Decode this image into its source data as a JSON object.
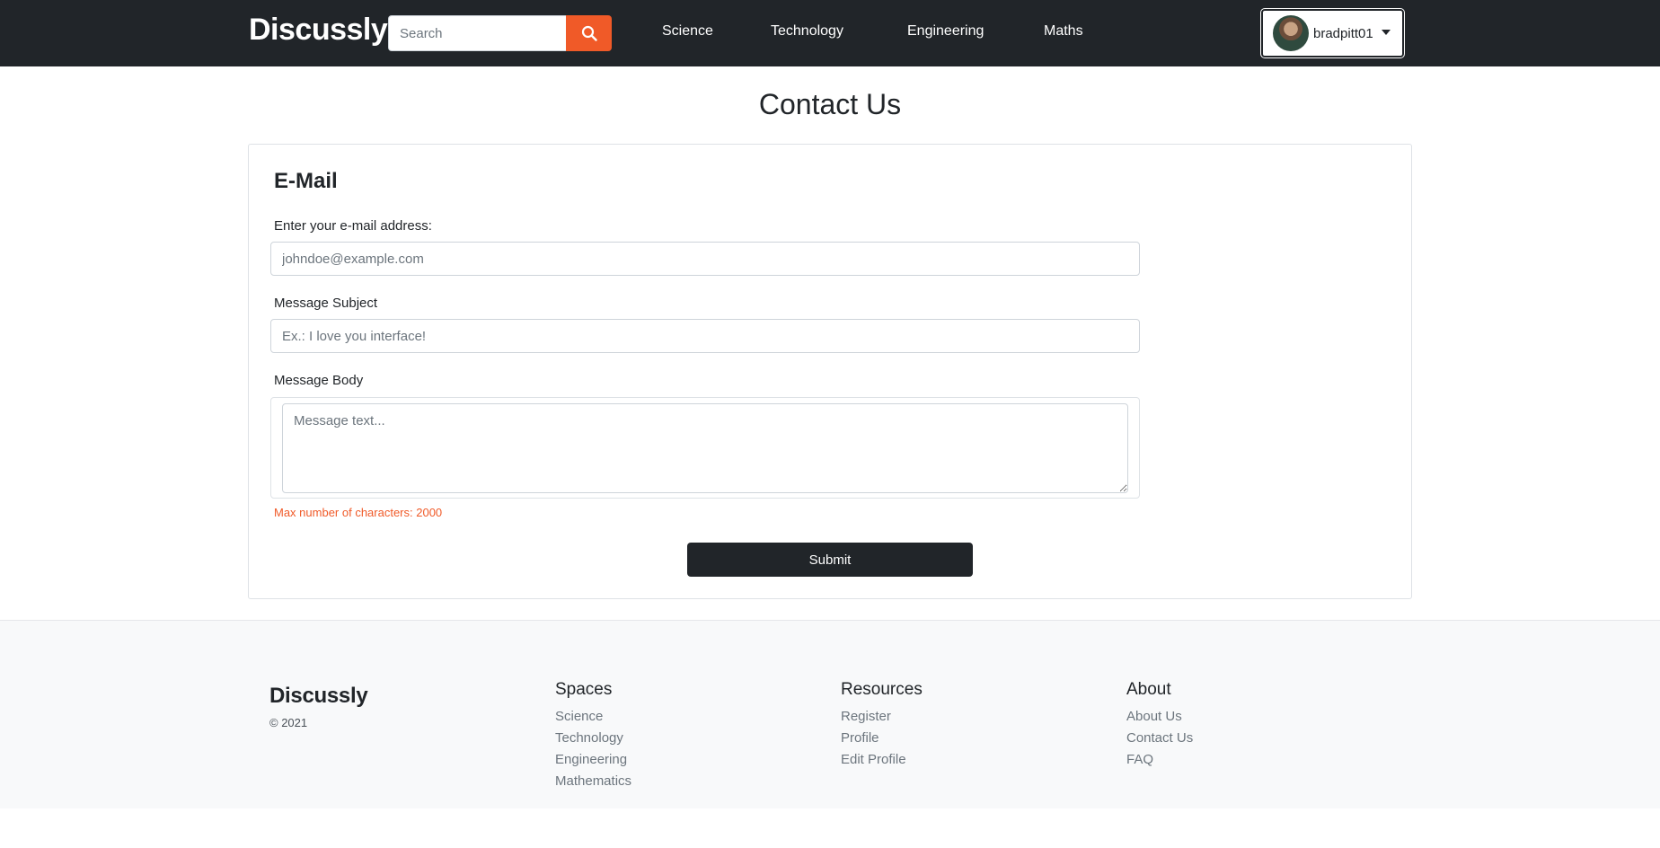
{
  "navbar": {
    "brand": "Discussly",
    "search_placeholder": "Search",
    "links": [
      "Science",
      "Technology",
      "Engineering",
      "Maths"
    ],
    "username": "bradpitt01",
    "accent_color": "#f05a28",
    "background_color": "#212529"
  },
  "main": {
    "title": "Contact Us",
    "form": {
      "heading": "E-Mail",
      "email_label": "Enter your e-mail address:",
      "email_placeholder": "johndoe@example.com",
      "subject_label": "Message Subject",
      "subject_placeholder": "Ex.: I love you interface!",
      "body_label": "Message Body",
      "body_placeholder": "Message text...",
      "hint": "Max number of characters: 2000",
      "submit_label": "Submit"
    }
  },
  "footer": {
    "brand": "Discussly",
    "copyright": "© 2021",
    "columns": [
      {
        "title": "Spaces",
        "links": [
          "Science",
          "Technology",
          "Engineering",
          "Mathematics"
        ]
      },
      {
        "title": "Resources",
        "links": [
          "Register",
          "Profile",
          "Edit Profile"
        ]
      },
      {
        "title": "About",
        "links": [
          "About Us",
          "Contact Us",
          "FAQ"
        ]
      }
    ]
  },
  "icons": {
    "search_button": "search-icon",
    "user_menu": "chevron-down-icon"
  }
}
